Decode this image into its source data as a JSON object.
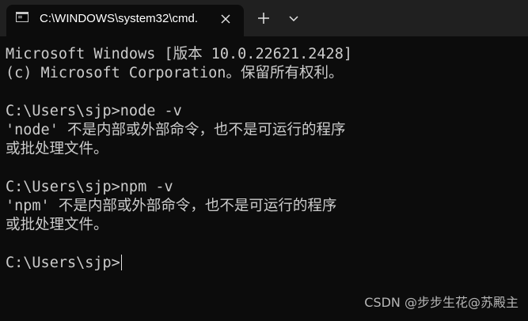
{
  "tab": {
    "title": "C:\\WINDOWS\\system32\\cmd.",
    "icon": "cmd-icon",
    "close_icon": "close-icon"
  },
  "titlebar": {
    "new_tab_icon": "plus-icon",
    "dropdown_icon": "chevron-down-icon"
  },
  "console": {
    "lines": [
      "Microsoft Windows [版本 10.0.22621.2428]",
      "(c) Microsoft Corporation。保留所有权利。",
      "",
      "C:\\Users\\sjp>node -v",
      "'node' 不是内部或外部命令，也不是可运行的程序",
      "或批处理文件。",
      "",
      "C:\\Users\\sjp>npm -v",
      "'npm' 不是内部或外部命令，也不是可运行的程序",
      "或批处理文件。",
      "",
      "C:\\Users\\sjp>"
    ]
  },
  "watermark": "CSDN @步步生花@苏殿主",
  "colors": {
    "titlebar_bg": "#202020",
    "console_bg": "#0c0c0c",
    "console_text": "#cccccc"
  }
}
